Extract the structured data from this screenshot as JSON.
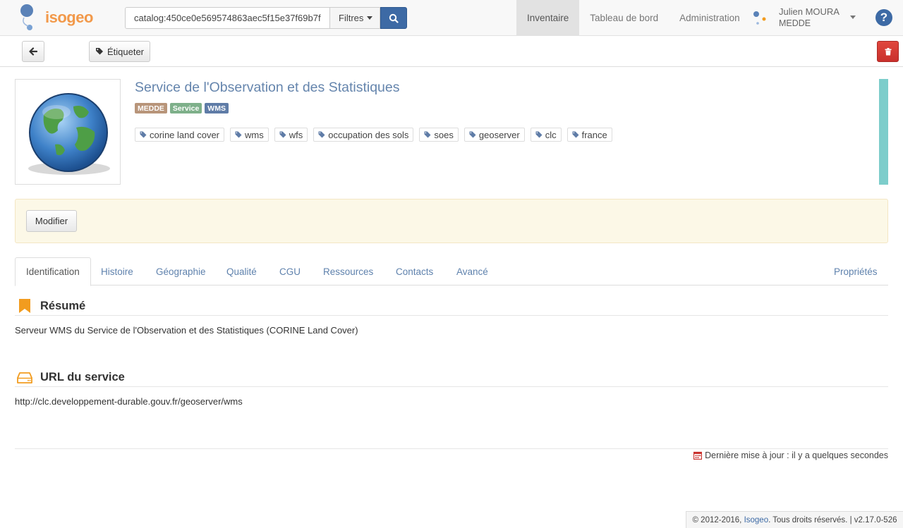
{
  "header": {
    "logo_text": "isogeo",
    "search_value": "catalog:450ce0e569574863aec5f15e37f69b7f",
    "filters_label": "Filtres",
    "nav": [
      {
        "label": "Inventaire"
      },
      {
        "label": "Tableau de bord"
      },
      {
        "label": "Administration"
      }
    ],
    "user_name": "Julien MOURA",
    "user_org": "MEDDE",
    "help_label": "?"
  },
  "toolbar": {
    "tag_label": "Étiqueter"
  },
  "resource": {
    "title": "Service de l'Observation et des Statistiques",
    "badges": [
      {
        "label": "MEDDE",
        "color": "#b8957a"
      },
      {
        "label": "Service",
        "color": "#7eb08a"
      },
      {
        "label": "WMS",
        "color": "#5f7ca7"
      }
    ],
    "keywords": [
      "corine land cover",
      "wms",
      "wfs",
      "occupation des sols",
      "soes",
      "geoserver",
      "clc",
      "france"
    ]
  },
  "actions": {
    "modify_label": "Modifier"
  },
  "tabs": [
    {
      "label": "Identification"
    },
    {
      "label": "Histoire"
    },
    {
      "label": "Géographie"
    },
    {
      "label": "Qualité"
    },
    {
      "label": "CGU"
    },
    {
      "label": "Ressources"
    },
    {
      "label": "Contacts"
    },
    {
      "label": "Avancé"
    },
    {
      "label": "Propriétés"
    }
  ],
  "sections": {
    "summary_title": "Résumé",
    "summary_text": "Serveur WMS du Service de l'Observation et des Statistiques (CORINE Land Cover)",
    "url_title": "URL du service",
    "url_text": "http://clc.developpement-durable.gouv.fr/geoserver/wms"
  },
  "footer": {
    "last_update": "Dernière mise à jour : il y a quelques secondes",
    "copyright_prefix": "© 2012-2016,",
    "copyright_link": "Isogeo",
    "copyright_suffix": ". Tous droits réservés. | v2.17.0-526"
  },
  "colors": {
    "accent": "#3d6aa5",
    "title": "#6585ad",
    "section_icon": "#f29c1f",
    "status_bar": "#7dcdcb",
    "danger": "#d9534f"
  }
}
